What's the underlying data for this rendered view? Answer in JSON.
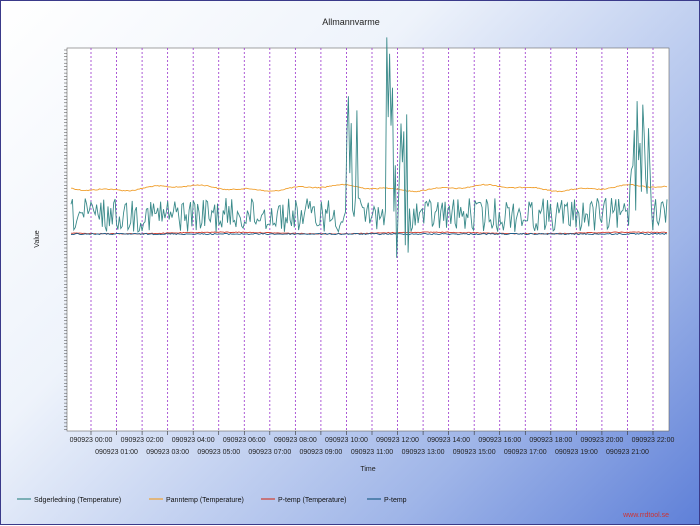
{
  "chart_data": {
    "type": "line",
    "title": "Allmannvarme",
    "xlabel": "Time",
    "ylabel": "Value",
    "grid": {
      "vertical": true,
      "horizontal": false
    },
    "legend_position": "bottom",
    "x_ticks": [
      {
        "label": "090923 00:00",
        "row": 1
      },
      {
        "label": "090923 01:00",
        "row": 2
      },
      {
        "label": "090923 02:00",
        "row": 1
      },
      {
        "label": "090923 03:00",
        "row": 2
      },
      {
        "label": "090923 04:00",
        "row": 1
      },
      {
        "label": "090923 05:00",
        "row": 2
      },
      {
        "label": "090923 06:00",
        "row": 1
      },
      {
        "label": "090923 07:00",
        "row": 2
      },
      {
        "label": "090923 08:00",
        "row": 1
      },
      {
        "label": "090923 09:00",
        "row": 2
      },
      {
        "label": "090923 10:00",
        "row": 1
      },
      {
        "label": "090923 11:00",
        "row": 2
      },
      {
        "label": "090923 12:00",
        "row": 1
      },
      {
        "label": "090923 13:00",
        "row": 2
      },
      {
        "label": "090923 14:00",
        "row": 1
      },
      {
        "label": "090923 15:00",
        "row": 2
      },
      {
        "label": "090923 16:00",
        "row": 1
      },
      {
        "label": "090923 17:00",
        "row": 2
      },
      {
        "label": "090923 18:00",
        "row": 1
      },
      {
        "label": "090923 19:00",
        "row": 2
      },
      {
        "label": "090923 20:00",
        "row": 1
      },
      {
        "label": "090923 21:00",
        "row": 2
      },
      {
        "label": "090923 22:00",
        "row": 1
      }
    ],
    "series": [
      {
        "name": "Sdgerledning (Temperature)",
        "color": "#3a8a8a"
      },
      {
        "name": "Panntemp (Temperature)",
        "color": "#f0a030"
      },
      {
        "name": "P-temp (Temperature)",
        "color": "#d04030"
      },
      {
        "name": "P-temp",
        "color": "#1f5f8a"
      }
    ]
  },
  "watermark": "www.rrdtool.se"
}
